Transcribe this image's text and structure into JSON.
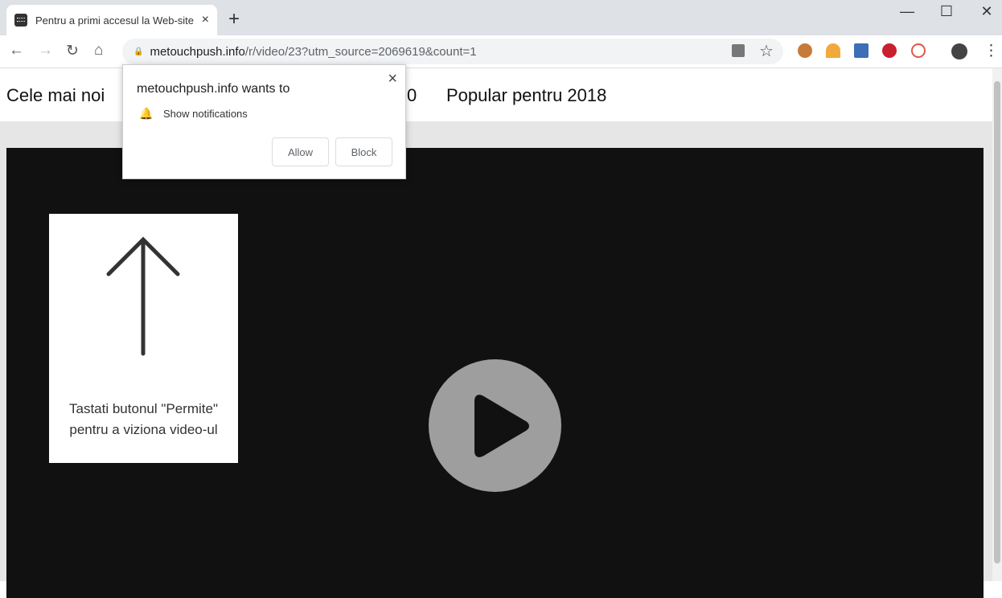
{
  "tab": {
    "title": "Pentru a primi accesul la Web-site",
    "close": "×",
    "new_tab": "+"
  },
  "window": {
    "minimize": "—",
    "maximize": "☐",
    "close": "✕"
  },
  "toolbar": {
    "back": "←",
    "forward": "→",
    "reload": "↻",
    "home": "⌂",
    "lock": "🔒",
    "url_host": "metouchpush.info",
    "url_path": "/r/video/23?utm_source=2069619&count=1",
    "star": "☆",
    "menu": "⋮"
  },
  "nav": {
    "items": [
      "Cele mai noi",
      "0",
      "Popular pentru 2018"
    ]
  },
  "card": {
    "line1": "Tastati butonul \"Permite\"",
    "line2": "pentru a viziona video-ul"
  },
  "popup": {
    "title": "metouchpush.info wants to",
    "permission": "Show notifications",
    "allow": "Allow",
    "block": "Block",
    "close": "×"
  }
}
